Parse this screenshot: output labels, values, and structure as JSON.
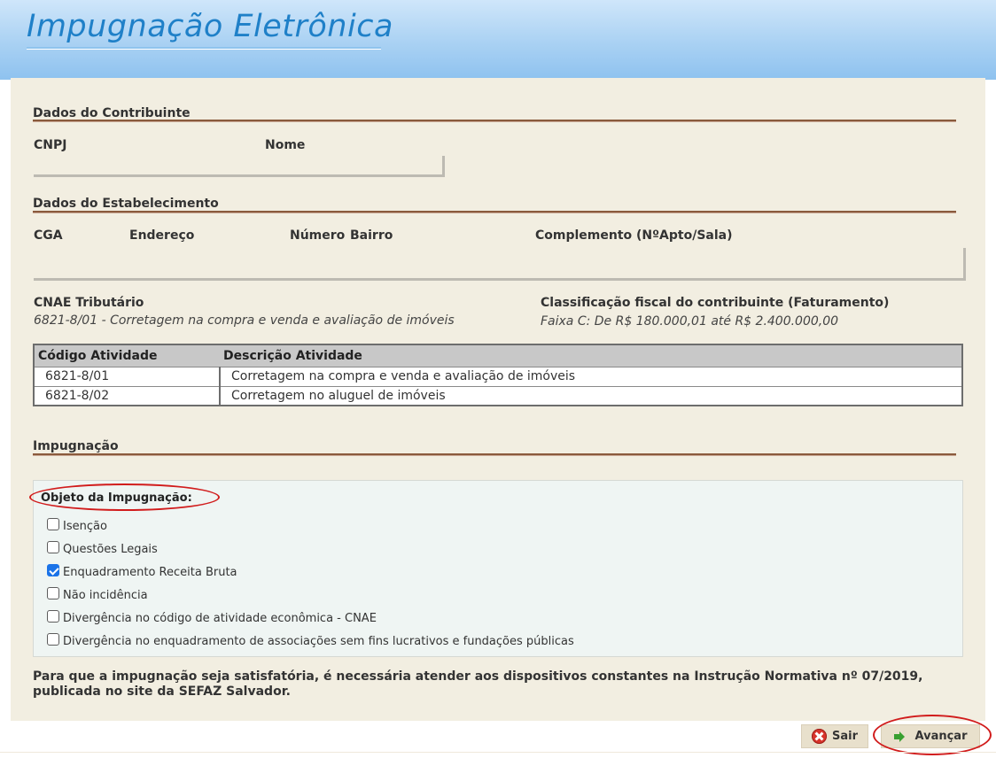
{
  "header": {
    "title": "Impugnação Eletrônica"
  },
  "contribuinte": {
    "section_title": "Dados do Contribuinte",
    "cnpj_label": "CNPJ",
    "nome_label": "Nome"
  },
  "estabelecimento": {
    "section_title": "Dados do Estabelecimento",
    "cga_label": "CGA",
    "endereco_label": "Endereço",
    "numero_label": "Número",
    "bairro_label": "Bairro",
    "complemento_label": "Complemento (NºApto/Sala)",
    "cnae_label": "CNAE Tributário",
    "cnae_value": "6821-8/01 - Corretagem na compra e venda e avaliação de imóveis",
    "classificacao_label": "Classificação fiscal do contribuinte (Faturamento)",
    "classificacao_value": "Faixa C: De R$ 180.000,01 até R$ 2.400.000,00"
  },
  "atividades": {
    "columns": [
      "Código Atividade",
      "Descrição Atividade"
    ],
    "rows": [
      {
        "codigo": "6821-8/01",
        "descricao": "Corretagem na compra e venda e avaliação de imóveis"
      },
      {
        "codigo": "6821-8/02",
        "descricao": "Corretagem no aluguel de imóveis"
      }
    ]
  },
  "impugnacao": {
    "section_title": "Impugnação",
    "objeto_title": "Objeto da Impugnação:",
    "options": [
      {
        "label": "Isenção",
        "checked": false
      },
      {
        "label": "Questões Legais",
        "checked": false
      },
      {
        "label": "Enquadramento Receita Bruta",
        "checked": true
      },
      {
        "label": "Não incidência",
        "checked": false
      },
      {
        "label": "Divergência no código de atividade econômica - CNAE",
        "checked": false
      },
      {
        "label": "Divergência no enquadramento de associações sem fins lucrativos e fundações públicas",
        "checked": false
      }
    ],
    "notice": "Para que a impugnação seja satisfatória, é necessária atender aos dispositivos constantes na Instrução Normativa nº 07/2019, publicada no site da SEFAZ Salvador."
  },
  "actions": {
    "sair_label": "Sair",
    "avancar_label": "Avançar",
    "sair_icon": "close-circle-icon",
    "avancar_icon": "arrow-right-icon"
  },
  "colors": {
    "title_blue": "#1f80c8",
    "panel_bg": "#f2eee1",
    "section_rule": "#8a5a3c",
    "highlight_red": "#d11c1c",
    "checkbox_blue": "#1a73e8"
  }
}
